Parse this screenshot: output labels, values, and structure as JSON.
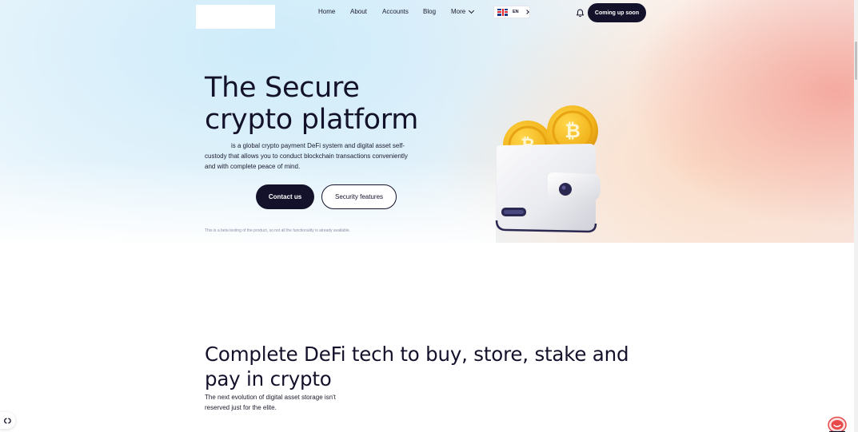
{
  "header": {
    "nav": [
      {
        "label": "Home"
      },
      {
        "label": "About"
      },
      {
        "label": "Accounts"
      },
      {
        "label": "Blog"
      },
      {
        "label": "More"
      }
    ],
    "language": "EN",
    "cta_label": "Coming up soon"
  },
  "hero": {
    "title_line1": "The Secure",
    "title_line2": "crypto platform",
    "description": "is a global crypto payment DeFi system and digital asset self-custody that allows you to conduct blockchain transactions conveniently and with complete peace of mind.",
    "contact_label": "Contact us",
    "security_label": "Security features",
    "beta_note": "This is a beta testing of the product, so not all the functionality is already available."
  },
  "section2": {
    "title": "Complete DeFi tech to buy, store, stake and pay in crypto",
    "description": "The next evolution of digital asset storage isn't reserved just for the elite."
  },
  "icons": {
    "bell": "bell-icon",
    "flag": "uk-flag-icon",
    "cookie": "cookie-settings-icon",
    "chat": "chat-icon"
  },
  "colors": {
    "primary_dark": "#14122b",
    "coin_gold": "#f2b51d",
    "accent_pink": "#f4a096"
  }
}
